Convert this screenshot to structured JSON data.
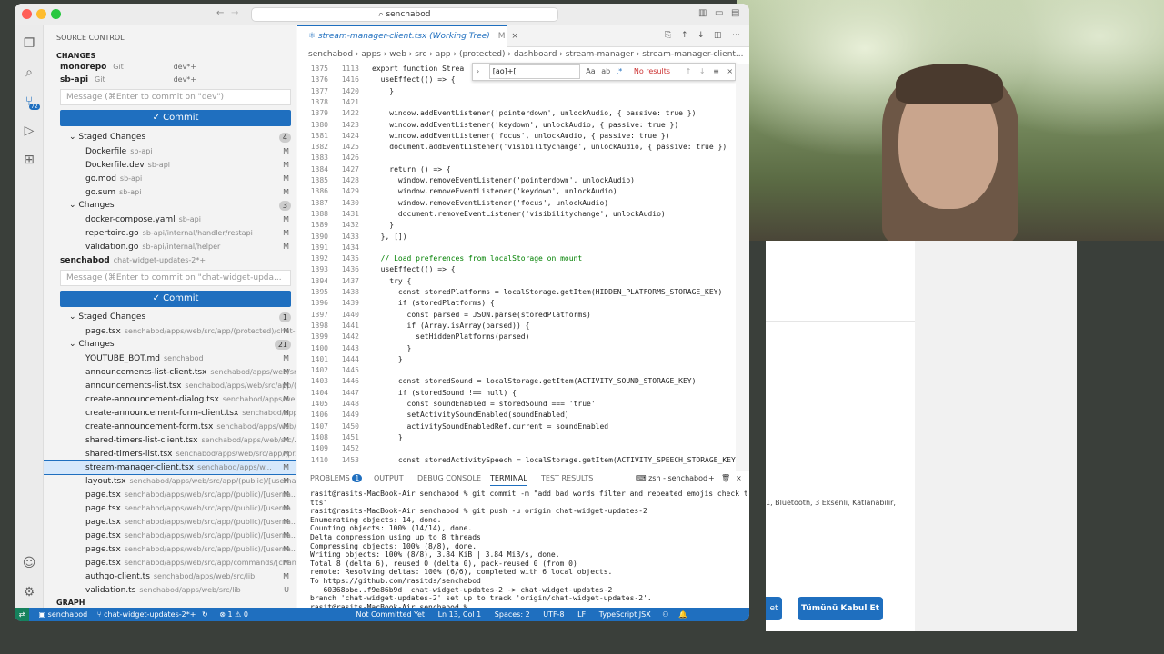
{
  "search_text": "senchabod",
  "source_control": {
    "title": "SOURCE CONTROL",
    "changes_header": "CHANGES",
    "graph_label": "GRAPH",
    "repos": [
      {
        "name": "monorepo",
        "vcs": "Git",
        "branch": "dev*+"
      },
      {
        "name": "sb-api",
        "vcs": "Git",
        "branch": "dev*+"
      },
      {
        "name": "senchabod",
        "vcs": "",
        "branch": "chat-widget-updates-2*+"
      }
    ],
    "sbapi_placeholder": "Message (⌘Enter to commit on \"dev\")",
    "senchabod_placeholder": "Message (⌘Enter to commit on \"chat-widget-upda...",
    "commit_label": "Commit",
    "sbapi_staged_label": "Staged Changes",
    "sbapi_staged_count": "4",
    "sbapi_staged": [
      {
        "name": "Dockerfile",
        "path": "sb-api",
        "status": "M"
      },
      {
        "name": "Dockerfile.dev",
        "path": "sb-api",
        "status": "M"
      },
      {
        "name": "go.mod",
        "path": "sb-api",
        "status": "M"
      },
      {
        "name": "go.sum",
        "path": "sb-api",
        "status": "M"
      }
    ],
    "sbapi_changes_label": "Changes",
    "sbapi_changes_count": "3",
    "sbapi_changes": [
      {
        "name": "docker-compose.yaml",
        "path": "sb-api",
        "status": "M"
      },
      {
        "name": "repertoire.go",
        "path": "sb-api/internal/handler/restapi",
        "status": "M"
      },
      {
        "name": "validation.go",
        "path": "sb-api/internal/helper",
        "status": "M"
      }
    ],
    "sench_staged_label": "Staged Changes",
    "sench_staged_count": "1",
    "sench_staged": [
      {
        "name": "page.tsx",
        "path": "senchabod/apps/web/src/app/(protected)/chat-...",
        "status": "M"
      }
    ],
    "sench_changes_label": "Changes",
    "sench_changes_count": "21",
    "sench_changes": [
      {
        "name": "YOUTUBE_BOT.md",
        "path": "senchabod",
        "status": "M"
      },
      {
        "name": "announcements-list-client.tsx",
        "path": "senchabod/apps/web/src/...",
        "status": "M"
      },
      {
        "name": "announcements-list.tsx",
        "path": "senchabod/apps/web/src/app/(...",
        "status": "M"
      },
      {
        "name": "create-announcement-dialog.tsx",
        "path": "senchabod/apps/web...",
        "status": "M"
      },
      {
        "name": "create-announcement-form-client.tsx",
        "path": "senchabod/apps/...",
        "status": "M"
      },
      {
        "name": "create-announcement-form.tsx",
        "path": "senchabod/apps/web/...",
        "status": "M"
      },
      {
        "name": "shared-timers-list-client.tsx",
        "path": "senchabod/apps/web/src/...",
        "status": "M"
      },
      {
        "name": "shared-timers-list.tsx",
        "path": "senchabod/apps/web/src/app/(pr...",
        "status": "M"
      },
      {
        "name": "stream-manager-client.tsx",
        "path": "senchabod/apps/w...",
        "status": "M"
      },
      {
        "name": "layout.tsx",
        "path": "senchabod/apps/web/src/app/(public)/[userna...",
        "status": "M"
      },
      {
        "name": "page.tsx",
        "path": "senchabod/apps/web/src/app/(public)/[userna...",
        "status": "M"
      },
      {
        "name": "page.tsx",
        "path": "senchabod/apps/web/src/app/(public)/[userna...",
        "status": "M"
      },
      {
        "name": "page.tsx",
        "path": "senchabod/apps/web/src/app/(public)/[userna...",
        "status": "M"
      },
      {
        "name": "page.tsx",
        "path": "senchabod/apps/web/src/app/(public)/[userna...",
        "status": "M"
      },
      {
        "name": "page.tsx",
        "path": "senchabod/apps/web/src/app/(public)/[userna...",
        "status": "M"
      },
      {
        "name": "page.tsx",
        "path": "senchabod/apps/web/src/app/commands/[chan...",
        "status": "M"
      },
      {
        "name": "authgo-client.ts",
        "path": "senchabod/apps/web/src/lib",
        "status": "M"
      },
      {
        "name": "validation.ts",
        "path": "senchabod/apps/web/src/lib",
        "status": "U"
      }
    ]
  },
  "editor": {
    "tab_title": "stream-manager-client.tsx (Working Tree)",
    "tab_status": "M",
    "breadcrumb": "senchabod  ›  apps  ›  web  ›  src  ›  app  ›  (protected)  ›  dashboard  ›  stream-manager  ›  stream-manager-client...",
    "find_query": "[ao]+[",
    "find_result": "No results",
    "lines": [
      {
        "a": "1375",
        "b": "1113",
        "code": "export function Strea"
      },
      {
        "a": "1376",
        "b": "1416",
        "code": "  useEffect(() => {"
      },
      {
        "a": "1377",
        "b": "1420",
        "code": "    }"
      },
      {
        "a": "1378",
        "b": "1421",
        "code": ""
      },
      {
        "a": "1379",
        "b": "1422",
        "code": "    window.addEventListener('pointerdown', unlockAudio, { passive: true })"
      },
      {
        "a": "1380",
        "b": "1423",
        "code": "    window.addEventListener('keydown', unlockAudio, { passive: true })"
      },
      {
        "a": "1381",
        "b": "1424",
        "code": "    window.addEventListener('focus', unlockAudio, { passive: true })"
      },
      {
        "a": "1382",
        "b": "1425",
        "code": "    document.addEventListener('visibilitychange', unlockAudio, { passive: true })"
      },
      {
        "a": "1383",
        "b": "1426",
        "code": ""
      },
      {
        "a": "1384",
        "b": "1427",
        "code": "    return () => {"
      },
      {
        "a": "1385",
        "b": "1428",
        "code": "      window.removeEventListener('pointerdown', unlockAudio)"
      },
      {
        "a": "1386",
        "b": "1429",
        "code": "      window.removeEventListener('keydown', unlockAudio)"
      },
      {
        "a": "1387",
        "b": "1430",
        "code": "      window.removeEventListener('focus', unlockAudio)"
      },
      {
        "a": "1388",
        "b": "1431",
        "code": "      document.removeEventListener('visibilitychange', unlockAudio)"
      },
      {
        "a": "1389",
        "b": "1432",
        "code": "    }"
      },
      {
        "a": "1390",
        "b": "1433",
        "code": "  }, [])"
      },
      {
        "a": "1391",
        "b": "1434",
        "code": ""
      },
      {
        "a": "1392",
        "b": "1435",
        "code": "  // Load preferences from localStorage on mount"
      },
      {
        "a": "1393",
        "b": "1436",
        "code": "  useEffect(() => {"
      },
      {
        "a": "1394",
        "b": "1437",
        "code": "    try {"
      },
      {
        "a": "1395",
        "b": "1438",
        "code": "      const storedPlatforms = localStorage.getItem(HIDDEN_PLATFORMS_STORAGE_KEY)"
      },
      {
        "a": "1396",
        "b": "1439",
        "code": "      if (storedPlatforms) {"
      },
      {
        "a": "1397",
        "b": "1440",
        "code": "        const parsed = JSON.parse(storedPlatforms)"
      },
      {
        "a": "1398",
        "b": "1441",
        "code": "        if (Array.isArray(parsed)) {"
      },
      {
        "a": "1399",
        "b": "1442",
        "code": "          setHiddenPlatforms(parsed)"
      },
      {
        "a": "1400",
        "b": "1443",
        "code": "        }"
      },
      {
        "a": "1401",
        "b": "1444",
        "code": "      }"
      },
      {
        "a": "1402",
        "b": "1445",
        "code": ""
      },
      {
        "a": "1403",
        "b": "1446",
        "code": "      const storedSound = localStorage.getItem(ACTIVITY_SOUND_STORAGE_KEY)"
      },
      {
        "a": "1404",
        "b": "1447",
        "code": "      if (storedSound !== null) {"
      },
      {
        "a": "1405",
        "b": "1448",
        "code": "        const soundEnabled = storedSound === 'true'"
      },
      {
        "a": "1406",
        "b": "1449",
        "code": "        setActivitySoundEnabled(soundEnabled)"
      },
      {
        "a": "1407",
        "b": "1450",
        "code": "        activitySoundEnabledRef.current = soundEnabled"
      },
      {
        "a": "1408",
        "b": "1451",
        "code": "      }"
      },
      {
        "a": "1409",
        "b": "1452",
        "code": ""
      },
      {
        "a": "1410",
        "b": "1453",
        "code": "      const storedActivitySpeech = localStorage.getItem(ACTIVITY_SPEECH_STORAGE_KEY)"
      }
    ]
  },
  "panel": {
    "tabs": [
      "PROBLEMS",
      "OUTPUT",
      "DEBUG CONSOLE",
      "TERMINAL",
      "TEST RESULTS"
    ],
    "problems_count": "1",
    "shell_label": "zsh - senchabod",
    "terminal_lines": [
      "rasit@rasits-MacBook-Air senchabod % git commit -m \"add bad words filter and repeated emojis check to",
      "tts\"",
      "rasit@rasits-MacBook-Air senchabod % git push -u origin chat-widget-updates-2",
      "Enumerating objects: 14, done.",
      "Counting objects: 100% (14/14), done.",
      "Delta compression using up to 8 threads",
      "Compressing objects: 100% (8/8), done.",
      "Writing objects: 100% (8/8), 3.84 KiB | 3.84 MiB/s, done.",
      "Total 8 (delta 6), reused 0 (delta 0), pack-reused 0 (from 0)",
      "remote: Resolving deltas: 100% (6/6), completed with 6 local objects.",
      "To https://github.com/rasitds/senchabod",
      "   60368bbe..f9e86b9d  chat-widget-updates-2 -> chat-widget-updates-2",
      "branch 'chat-widget-updates-2' set up to track 'origin/chat-widget-updates-2'.",
      "rasit@rasits-MacBook-Air senchabod % "
    ]
  },
  "status": {
    "repo": "senchabod",
    "branch": "chat-widget-updates-2*+",
    "problems": "⊗ 1 ⚠ 0",
    "commit_state": "Not Committed Yet",
    "cursor": "Ln 13, Col 1",
    "spaces": "Spaces: 2",
    "encoding": "UTF-8",
    "eol": "LF",
    "language": "TypeScript JSX"
  },
  "browser": {
    "product_text": "1, Bluetooth, 3 Eksenli, Katlanabilir,",
    "accept_all_label": "Tümünü Kabul Et",
    "partial_label": "et"
  },
  "colors": {
    "accent": "#1f6fbf",
    "statusbar": "#1f6fbf"
  }
}
